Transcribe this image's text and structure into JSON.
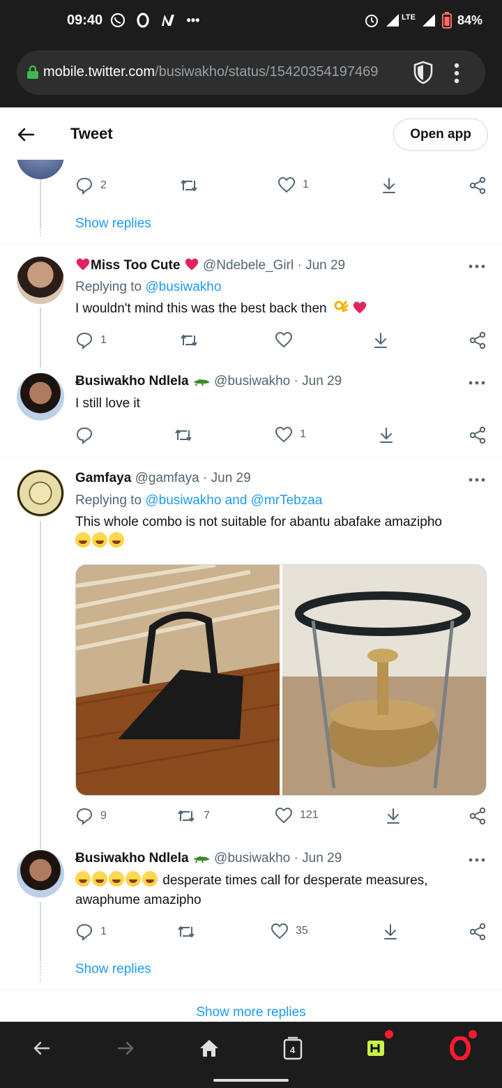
{
  "status_bar": {
    "time": "09:40",
    "battery": "84%",
    "network": "LTE",
    "notification_icons": [
      "whatsapp-icon",
      "opera-o-icon",
      "n-icon"
    ],
    "more_notifications": "•••"
  },
  "browser": {
    "url_domain": "mobile.twitter.com",
    "url_path": "/busiwakho/status/15420354197469",
    "tab_count": "4"
  },
  "header": {
    "title": "Tweet",
    "open_app_label": "Open app"
  },
  "top_stub": {
    "stats": {
      "reply": "2",
      "retweet": "",
      "like": "1"
    },
    "show_replies": "Show replies"
  },
  "tweets": [
    {
      "name": "Miss Too Cute",
      "handle": "@Ndebele_Girl",
      "date": "· Jun 29",
      "replying_label": "Replying to ",
      "replying_to": "@busiwakho",
      "text": "I wouldn't mind this was the best back then",
      "stats": {
        "reply": "1",
        "retweet": "",
        "like": ""
      }
    },
    {
      "name": "Ƀusiwakho Ndlela",
      "handle": "@busiwakho",
      "date": "· Jun 29",
      "text": "I still love it",
      "stats": {
        "reply": "",
        "retweet": "",
        "like": "1"
      }
    },
    {
      "name": "Gamfaya",
      "handle": "@gamfaya",
      "date": "· Jun 29",
      "replying_label": "Replying to ",
      "replying_to": "@busiwakho and @mrTebzaa",
      "text": "This whole combo is not suitable for abantu abafake amazipho",
      "stats": {
        "reply": "9",
        "retweet": "7",
        "like": "121"
      }
    },
    {
      "name": "Ƀusiwakho Ndlela",
      "handle": "@busiwakho",
      "date": "· Jun 29",
      "text_line1": "desperate times call for desperate measures,",
      "text_line2": "awaphume amazipho",
      "stats": {
        "reply": "1",
        "retweet": "",
        "like": "35"
      },
      "show_replies": "Show replies"
    }
  ],
  "show_more_replies": "Show more replies",
  "colors": {
    "link": "#1d9bf0",
    "muted": "#536471",
    "dark_bar": "#1c1c1c"
  }
}
